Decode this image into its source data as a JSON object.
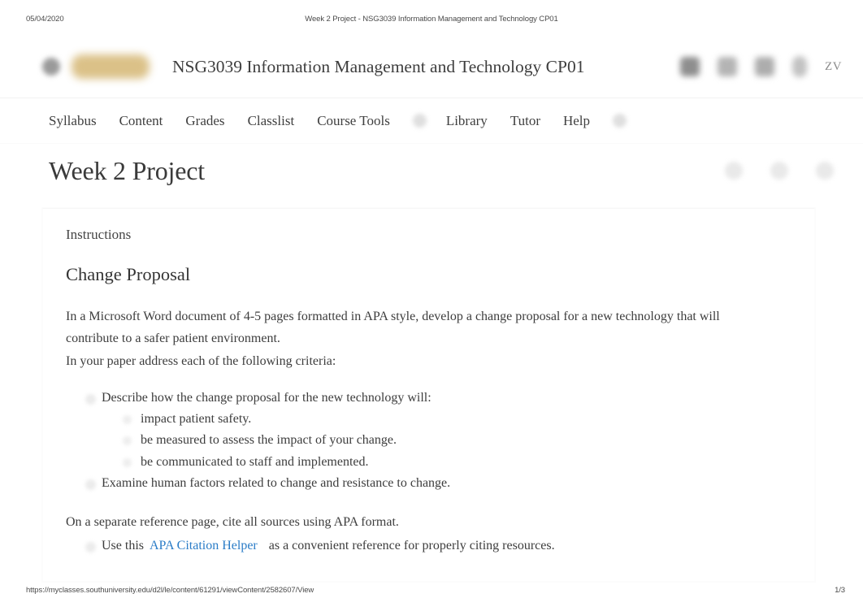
{
  "print": {
    "date": "05/04/2020",
    "document_title": "Week 2 Project - NSG3039 Information Management and Technology CP01",
    "url": "https://myclasses.southuniversity.edu/d2l/le/content/61291/viewContent/2582607/View",
    "page_indicator": "1/3"
  },
  "header": {
    "course_title": "NSG3039 Information Management and Technology CP01",
    "user_initials": "ZV",
    "menu_icon": "hamburger-menu-icon",
    "logo_color": "#d8bc7e",
    "icons": [
      "home-icon",
      "message-icon",
      "notifications-icon",
      "subscriptions-icon"
    ]
  },
  "coursenav": {
    "items": [
      {
        "label": "Syllabus",
        "has_caret": false
      },
      {
        "label": "Content",
        "has_caret": false
      },
      {
        "label": "Grades",
        "has_caret": false
      },
      {
        "label": "Classlist",
        "has_caret": false
      },
      {
        "label": "Course Tools",
        "has_caret": true
      },
      {
        "label": "Library",
        "has_caret": false
      },
      {
        "label": "Tutor",
        "has_caret": false
      },
      {
        "label": "Help",
        "has_caret": true
      }
    ]
  },
  "page": {
    "title": "Week 2 Project",
    "actions": [
      "print-icon",
      "settings-icon",
      "more-options-icon"
    ]
  },
  "content": {
    "instructions_label": "Instructions",
    "heading": "Change Proposal",
    "paragraph_1": "In a Microsoft Word document of 4-5 pages formatted in APA style, develop a change proposal for a new technology that will contribute to a safer patient environment.",
    "paragraph_2": "In your paper address each of the following criteria:",
    "bullet_1": "Describe how the change proposal for the new technology will:",
    "sub_bullets": [
      "impact patient safety.",
      "be measured to assess the impact of your change.",
      "be communicated to staff and implemented."
    ],
    "bullet_2": "Examine human factors related to change and resistance to change.",
    "paragraph_3": "On a separate reference page, cite all sources using APA format.",
    "final_bullet_prefix": "Use this",
    "final_bullet_link": "APA Citation Helper",
    "final_bullet_suffix": "as a convenient reference for properly citing resources.",
    "link_color": "#2a7cc7"
  }
}
